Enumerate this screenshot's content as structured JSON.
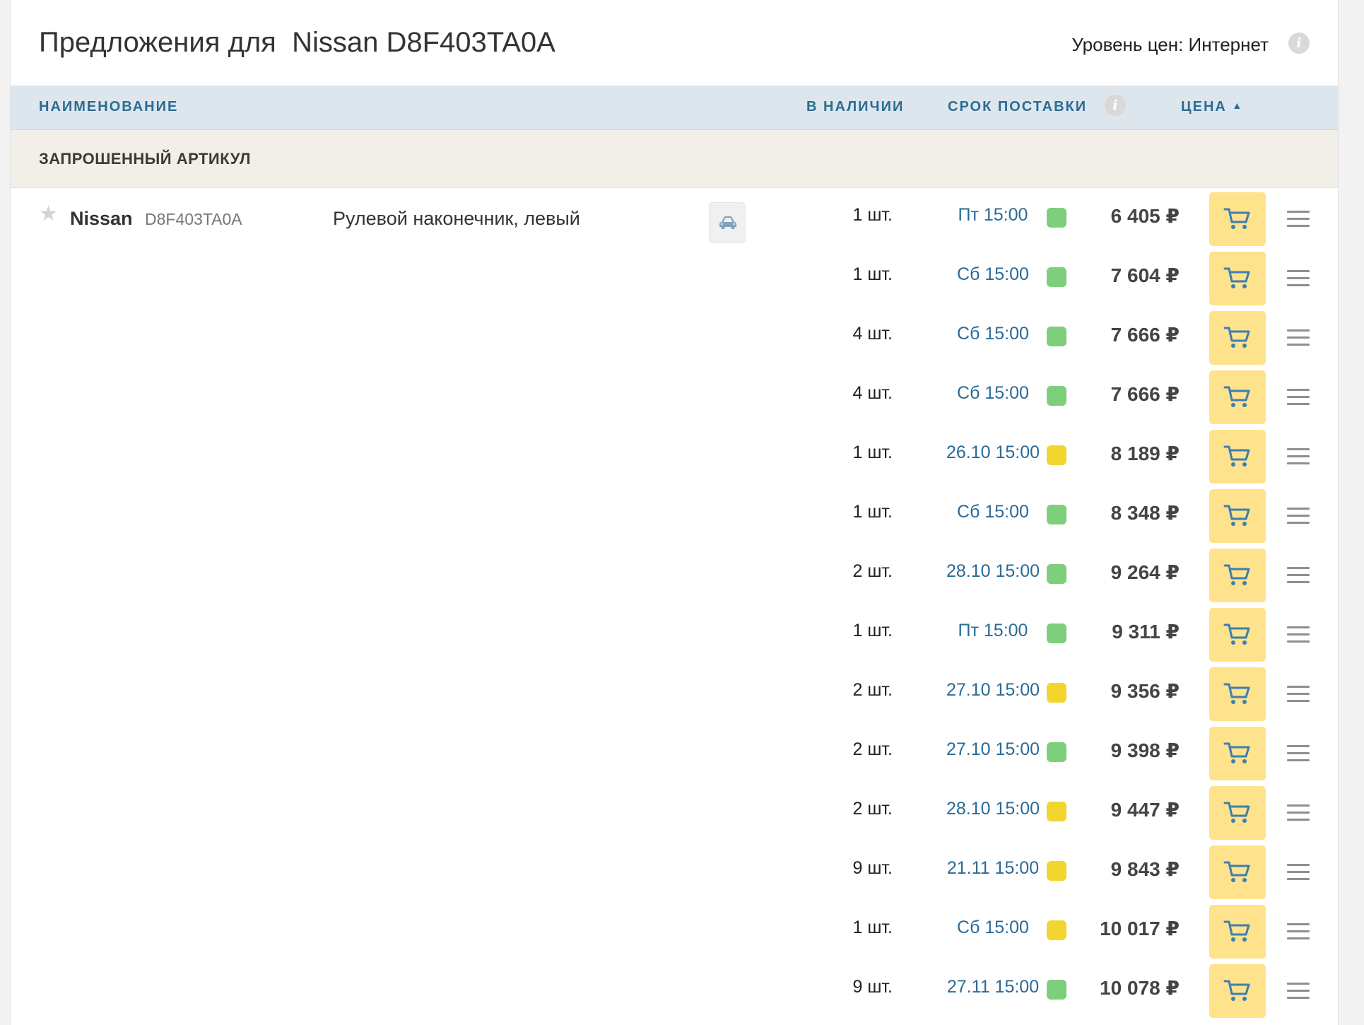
{
  "header": {
    "title": "Предложения для  Nissan D8F403TA0A",
    "price_level": "Уровень цен: Интернет",
    "info_glyph": "i"
  },
  "columns": {
    "name": "НАИМЕНОВАНИЕ",
    "in_stock": "В НАЛИЧИИ",
    "delivery": "СРОК ПОСТАВКИ",
    "price": "ЦЕНА",
    "price_sort_icon": "▲",
    "info_glyph": "i"
  },
  "section": {
    "label": "ЗАПРОШЕННЫЙ АРТИКУЛ"
  },
  "product": {
    "brand": "Nissan",
    "article": "D8F403TA0A",
    "name": "Рулевой наконечник, левый",
    "star_icon": "★",
    "car_icon": "car-icon"
  },
  "colors": {
    "green": "#7dcf7b",
    "yellow": "#f3d530",
    "cart_bg": "#ffe28c",
    "link": "#2b6a95"
  },
  "offers": [
    {
      "qty": "1 шт.",
      "delivery": "Пт 15:00",
      "status": "green",
      "price": "6 405 ₽"
    },
    {
      "qty": "1 шт.",
      "delivery": "Сб 15:00",
      "status": "green",
      "price": "7 604 ₽"
    },
    {
      "qty": "4 шт.",
      "delivery": "Сб 15:00",
      "status": "green",
      "price": "7 666 ₽"
    },
    {
      "qty": "4 шт.",
      "delivery": "Сб 15:00",
      "status": "green",
      "price": "7 666 ₽"
    },
    {
      "qty": "1 шт.",
      "delivery": "26.10 15:00",
      "status": "yellow",
      "price": "8 189 ₽"
    },
    {
      "qty": "1 шт.",
      "delivery": "Сб 15:00",
      "status": "green",
      "price": "8 348 ₽"
    },
    {
      "qty": "2 шт.",
      "delivery": "28.10 15:00",
      "status": "green",
      "price": "9 264 ₽"
    },
    {
      "qty": "1 шт.",
      "delivery": "Пт 15:00",
      "status": "green",
      "price": "9 311 ₽"
    },
    {
      "qty": "2 шт.",
      "delivery": "27.10 15:00",
      "status": "yellow",
      "price": "9 356 ₽"
    },
    {
      "qty": "2 шт.",
      "delivery": "27.10 15:00",
      "status": "green",
      "price": "9 398 ₽"
    },
    {
      "qty": "2 шт.",
      "delivery": "28.10 15:00",
      "status": "yellow",
      "price": "9 447 ₽"
    },
    {
      "qty": "9 шт.",
      "delivery": "21.11 15:00",
      "status": "yellow",
      "price": "9 843 ₽"
    },
    {
      "qty": "1 шт.",
      "delivery": "Сб 15:00",
      "status": "yellow",
      "price": "10 017 ₽"
    },
    {
      "qty": "9 шт.",
      "delivery": "27.11 15:00",
      "status": "green",
      "price": "10 078 ₽"
    }
  ]
}
